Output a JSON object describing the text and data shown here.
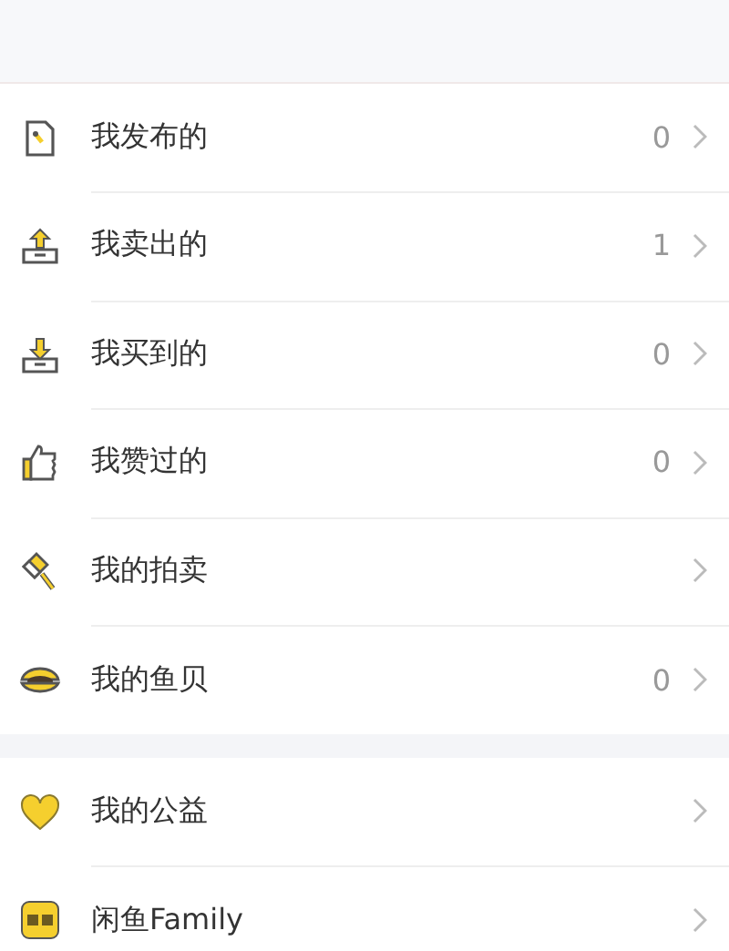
{
  "sections": [
    {
      "items": [
        {
          "label": "我发布的",
          "count": "0"
        },
        {
          "label": "我卖出的",
          "count": "1"
        },
        {
          "label": "我买到的",
          "count": "0"
        },
        {
          "label": "我赞过的",
          "count": "0"
        },
        {
          "label": "我的拍卖"
        },
        {
          "label": "我的鱼贝",
          "count": "0"
        }
      ]
    },
    {
      "items": [
        {
          "label": "我的公益"
        },
        {
          "label": "闲鱼Family"
        }
      ]
    }
  ]
}
